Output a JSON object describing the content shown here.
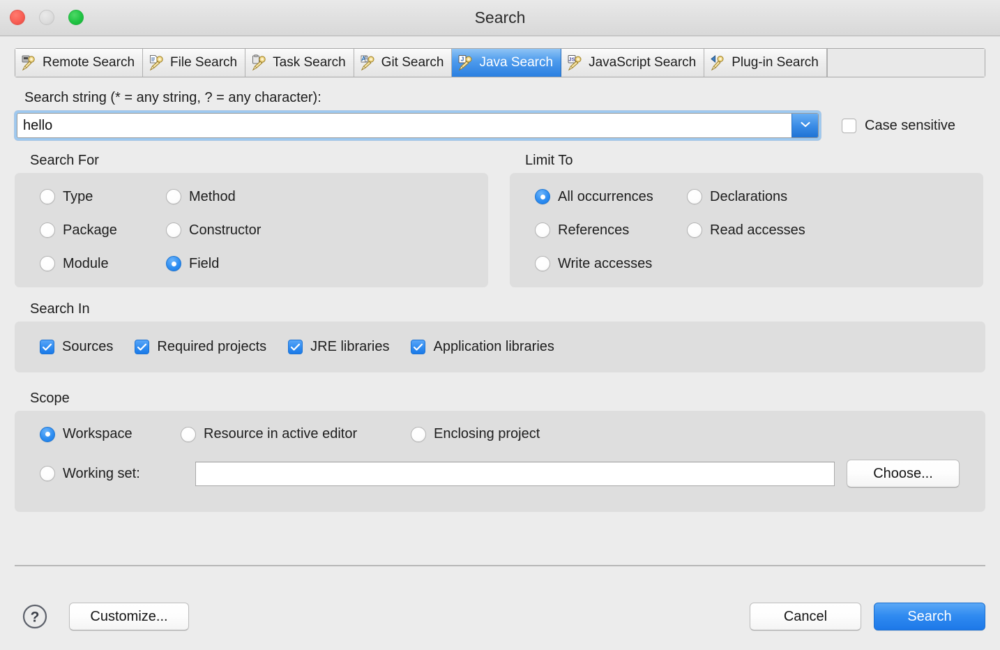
{
  "window": {
    "title": "Search",
    "traffic_lights": [
      "close-button",
      "minimize-button",
      "maximize-button"
    ]
  },
  "tabs": [
    {
      "label": "Remote Search",
      "icon": "remote-search-icon",
      "active": false
    },
    {
      "label": "File Search",
      "icon": "file-search-icon",
      "active": false
    },
    {
      "label": "Task Search",
      "icon": "task-search-icon",
      "active": false
    },
    {
      "label": "Git Search",
      "icon": "git-search-icon",
      "active": false
    },
    {
      "label": "Java Search",
      "icon": "java-search-icon",
      "active": true
    },
    {
      "label": "JavaScript Search",
      "icon": "javascript-search-icon",
      "active": false
    },
    {
      "label": "Plug-in Search",
      "icon": "plugin-search-icon",
      "active": false
    }
  ],
  "search_string": {
    "label": "Search string (* = any string, ? = any character):",
    "value": "hello",
    "placeholder": "",
    "dropdown_icon": "chevron-down-icon"
  },
  "case_sensitive": {
    "label": "Case sensitive",
    "checked": false
  },
  "search_for": {
    "title": "Search For",
    "options": [
      {
        "label": "Type",
        "selected": false
      },
      {
        "label": "Package",
        "selected": false
      },
      {
        "label": "Module",
        "selected": false
      },
      {
        "label": "Method",
        "selected": false
      },
      {
        "label": "Constructor",
        "selected": false
      },
      {
        "label": "Field",
        "selected": true
      }
    ]
  },
  "limit_to": {
    "title": "Limit To",
    "options": [
      {
        "label": "All occurrences",
        "selected": true
      },
      {
        "label": "References",
        "selected": false
      },
      {
        "label": "Write accesses",
        "selected": false
      },
      {
        "label": "Declarations",
        "selected": false
      },
      {
        "label": "Read accesses",
        "selected": false
      }
    ]
  },
  "search_in": {
    "title": "Search In",
    "options": [
      {
        "label": "Sources",
        "checked": true
      },
      {
        "label": "Required projects",
        "checked": true
      },
      {
        "label": "JRE libraries",
        "checked": true
      },
      {
        "label": "Application libraries",
        "checked": true
      }
    ]
  },
  "scope": {
    "title": "Scope",
    "options": [
      {
        "label": "Workspace",
        "selected": true
      },
      {
        "label": "Resource in active editor",
        "selected": false
      },
      {
        "label": "Enclosing project",
        "selected": false
      },
      {
        "label": "Working set:",
        "selected": false
      }
    ],
    "working_set_value": "",
    "working_set_placeholder": "",
    "choose_label": "Choose..."
  },
  "footer": {
    "help_icon": "help-question-icon",
    "customize_label": "Customize...",
    "cancel_label": "Cancel",
    "search_label": "Search"
  },
  "colors": {
    "accent_blue": "#2f8af0",
    "dialog_bg": "#ececec",
    "group_bg": "#dedede",
    "selected_tab": "#2a7fe0"
  }
}
